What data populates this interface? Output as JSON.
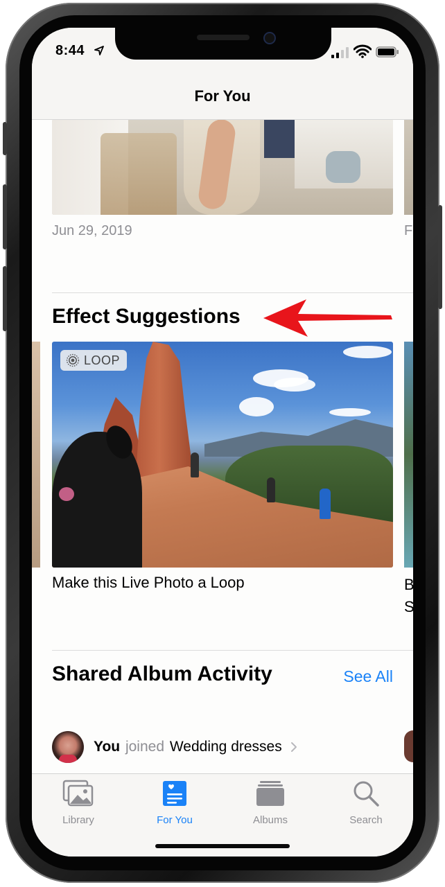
{
  "status_bar": {
    "time": "8:44"
  },
  "nav": {
    "title": "For You"
  },
  "memories": {
    "date": "Jun 29, 2019",
    "peek_date_letter": "F"
  },
  "effect_suggestions": {
    "title": "Effect Suggestions",
    "badge": "LOOP",
    "caption": "Make this Live Photo a Loop",
    "peek_caption": "B S"
  },
  "shared_album": {
    "title": "Shared Album Activity",
    "see_all": "See All",
    "activity": {
      "user": "You",
      "action": "joined",
      "album": "Wedding dresses"
    }
  },
  "tab_bar": {
    "tabs": [
      {
        "label": "Library",
        "icon": "photo-library-icon"
      },
      {
        "label": "For You",
        "icon": "for-you-icon",
        "active": true
      },
      {
        "label": "Albums",
        "icon": "albums-icon"
      },
      {
        "label": "Search",
        "icon": "search-icon"
      }
    ]
  },
  "colors": {
    "accent": "#1a82f7",
    "secondary_text": "#8e8e93",
    "annotation_arrow": "#e8151b"
  }
}
